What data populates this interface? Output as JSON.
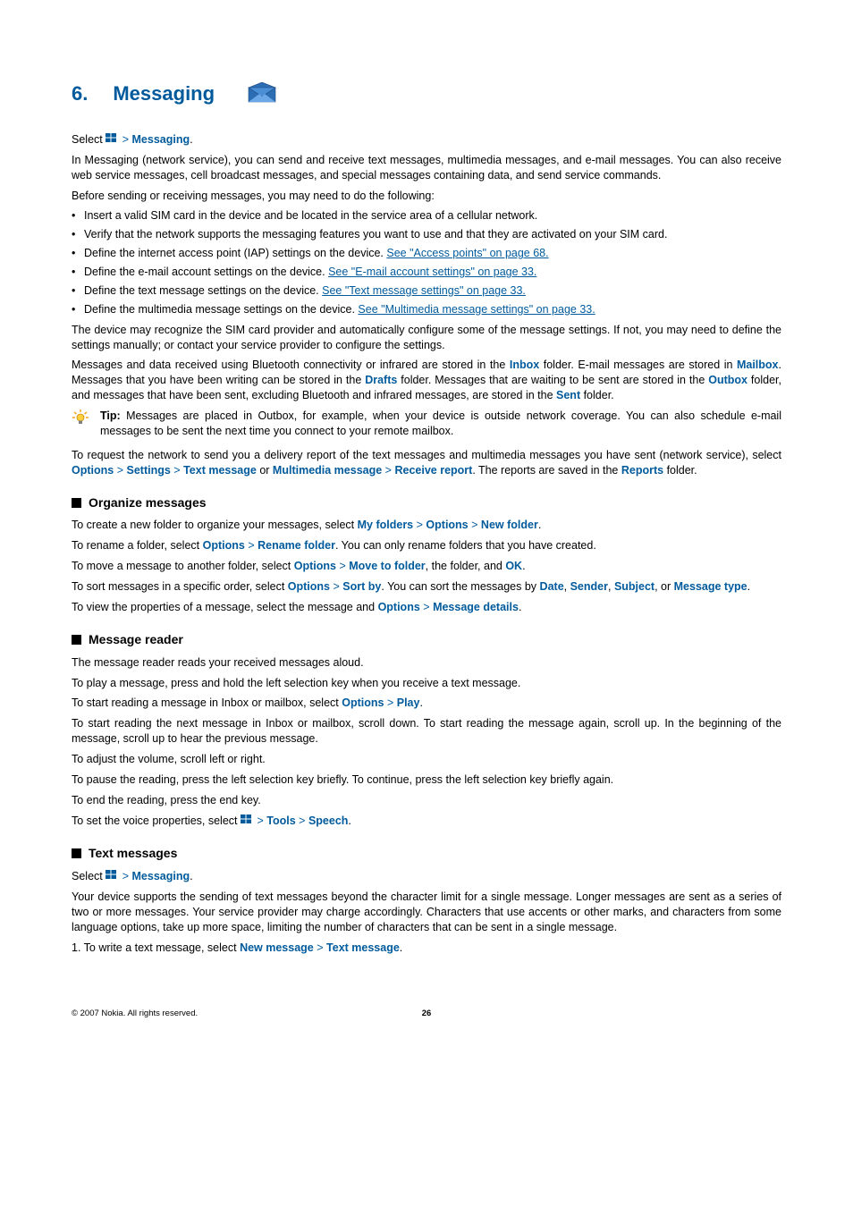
{
  "chapter": {
    "num": "6.",
    "name": "Messaging"
  },
  "intro": {
    "select_prefix": "Select ",
    "select_brand": "Messaging",
    "p1": "In Messaging (network service), you can send and receive text messages, multimedia messages, and e-mail messages. You can also receive web service messages, cell broadcast messages, and special messages containing data, and send service commands.",
    "p2": "Before sending or receiving messages, you may need to do the following:",
    "bullets": {
      "b1": "Insert a valid SIM card in the device and be located in the service area of a cellular network.",
      "b2": "Verify that the network supports the messaging features you want to use and that they are activated on your SIM card.",
      "b3_pre": "Define the internet access point (IAP) settings on the device. ",
      "b3_link": "See \"Access points\" on page 68.",
      "b4_pre": "Define the e-mail account settings on the device. ",
      "b4_link": "See \"E-mail account settings\" on page 33.",
      "b5_pre": "Define the text message settings on the device. ",
      "b5_link": "See \"Text message settings\" on page 33.",
      "b6_pre": "Define the multimedia message settings on the device. ",
      "b6_link": "See \"Multimedia message settings\" on page 33."
    },
    "p3": "The device may recognize the SIM card provider and automatically configure some of the message settings. If not, you may need to define the settings manually; or contact your service provider to configure the settings.",
    "p4_a": "Messages and data received using Bluetooth connectivity or infrared are stored in the ",
    "p4_inbox": "Inbox",
    "p4_b": " folder. E-mail messages are stored in ",
    "p4_mailbox": "Mailbox",
    "p4_c": ". Messages that you have been writing can be stored in the ",
    "p4_drafts": "Drafts",
    "p4_d": " folder. Messages that are waiting to be sent are stored in the ",
    "p4_outbox": "Outbox",
    "p4_e": " folder, and messages that have been sent, excluding Bluetooth and infrared messages, are stored in the ",
    "p4_sent": "Sent",
    "p4_f": " folder.",
    "tip_label": "Tip: ",
    "tip_text": "Messages are placed in Outbox, for example, when your device is outside network coverage. You can also schedule e-mail messages to be sent the next time you connect to your remote mailbox.",
    "p5_a": "To request the network to send you a delivery report of the text messages and multimedia messages you have sent (network service), select ",
    "p5_options": "Options",
    "p5_settings": "Settings",
    "p5_textmsg": "Text message",
    "p5_or": " or ",
    "p5_mms": "Multimedia message",
    "p5_receive": "Receive report",
    "p5_b": ". The reports are saved in the ",
    "p5_reports": "Reports",
    "p5_c": " folder."
  },
  "organize": {
    "title": "Organize messages",
    "p1_a": "To create a new folder to organize your messages, select ",
    "p1_myfolders": "My folders",
    "p1_options": "Options",
    "p1_newfolder": "New folder",
    "p2_a": "To rename a folder, select ",
    "p2_options": "Options",
    "p2_rename": "Rename folder",
    "p2_b": ". You can only rename folders that you have created.",
    "p3_a": "To move a message to another folder, select ",
    "p3_options": "Options",
    "p3_move": "Move to folder",
    "p3_b": ", the folder, and ",
    "p3_ok": "OK",
    "p4_a": "To sort messages in a specific order, select ",
    "p4_options": "Options",
    "p4_sort": "Sort by",
    "p4_b": ". You can sort the messages by ",
    "p4_date": "Date",
    "p4_sender": "Sender",
    "p4_subject": "Subject",
    "p4_or": ", or ",
    "p4_msgtype": "Message type",
    "p5_a": "To view the properties of a message, select the message and ",
    "p5_options": "Options",
    "p5_details": "Message details"
  },
  "reader": {
    "title": "Message reader",
    "p1": "The message reader reads your received messages aloud.",
    "p2": "To play a message, press and hold the left selection key when you receive a text message.",
    "p3_a": "To start reading a message in Inbox or mailbox, select ",
    "p3_options": "Options",
    "p3_play": "Play",
    "p4": "To start reading the next message in Inbox or mailbox, scroll down. To start reading the message again, scroll up. In the beginning of the message, scroll up to hear the previous message.",
    "p5": "To adjust the volume, scroll left or right.",
    "p6": "To pause the reading, press the left selection key briefly. To continue, press the left selection key briefly again.",
    "p7": "To end the reading, press the end key.",
    "p8_a": "To set the voice properties, select ",
    "p8_tools": "Tools",
    "p8_speech": "Speech"
  },
  "textmsg": {
    "title": "Text messages",
    "select_prefix": "Select ",
    "select_brand": "Messaging",
    "p1": "Your device supports the sending of text messages beyond the character limit for a single message. Longer messages are sent as a series of two or more messages. Your service provider may charge accordingly. Characters that use accents or other marks, and characters from some language options, take up more space, limiting the number of characters that can be sent in a single message.",
    "step1_a": "1.  To write a text message, select ",
    "step1_newmsg": "New message",
    "step1_textmsg": "Text message"
  },
  "footer": {
    "copy": "© 2007 Nokia. All rights reserved.",
    "page": "26"
  },
  "sep": " > ",
  "period": ".",
  "comma": ", "
}
